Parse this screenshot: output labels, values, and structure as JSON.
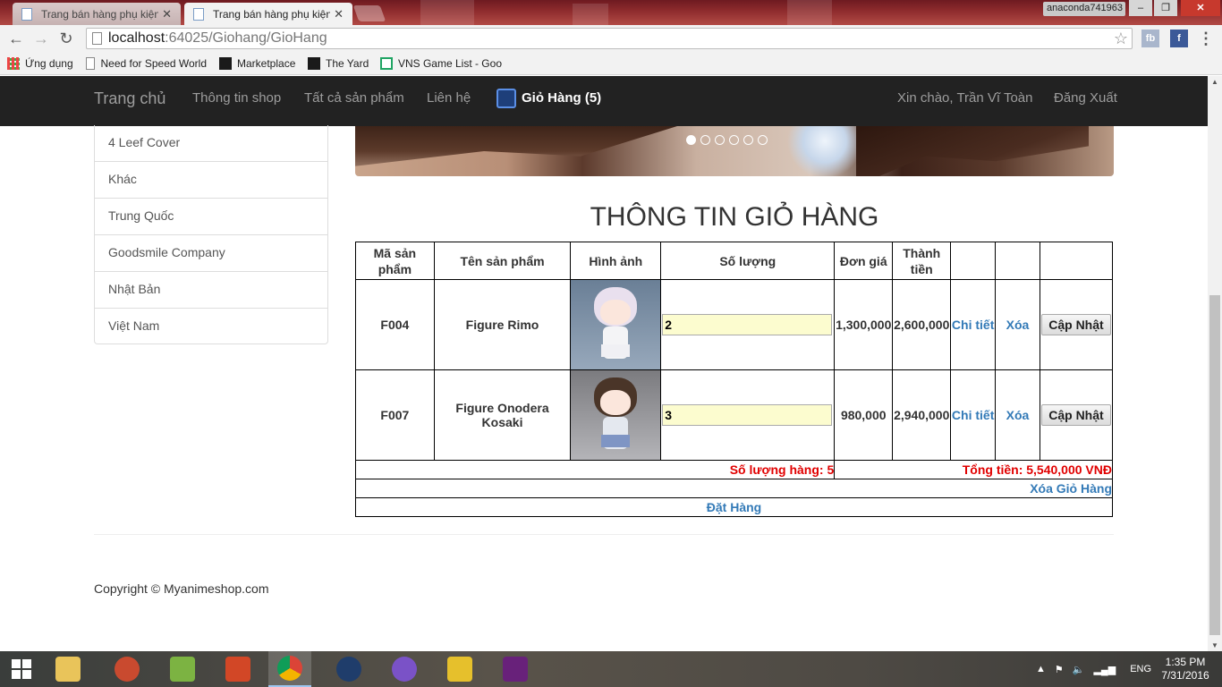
{
  "browser": {
    "tabs": [
      {
        "title": "Trang bán hàng phụ kiện",
        "active": false
      },
      {
        "title": "Trang bán hàng phụ kiện",
        "active": true
      }
    ],
    "profile": "anaconda741963",
    "url_host": "localhost",
    "url_path": ":64025/Giohang/GioHang",
    "bookmarks": [
      "Ứng dụng",
      "Need for Speed World",
      "Marketplace",
      "The Yard",
      "VNS Game List - Goo"
    ],
    "extensions": [
      "fb"
    ]
  },
  "navbar": {
    "brand": "Trang chủ",
    "links": [
      "Thông tin shop",
      "Tất cả sản phẩm",
      "Liên hệ"
    ],
    "cart": "Giỏ Hàng (5)",
    "greeting": "Xin chào, Trần Vĩ Toàn",
    "logout": "Đăng Xuất"
  },
  "sidebar": {
    "items": [
      "4 Leef Cover",
      "Khác",
      "Trung Quốc",
      "Goodsmile Company",
      "Nhật Bản",
      "Việt Nam"
    ]
  },
  "carousel": {
    "slide_count": 6,
    "active_index": 0
  },
  "cart": {
    "title": "THÔNG TIN GIỎ HÀNG",
    "headers": [
      "Mã sản phẩm",
      "Tên sản phẩm",
      "Hình ảnh",
      "Số lượng",
      "Đơn giá",
      "Thành tiền",
      "",
      "",
      ""
    ],
    "rows": [
      {
        "code": "F004",
        "name": "Figure Rimo",
        "image": "figure-rimo-image",
        "qty": "2",
        "price": "1,300,000",
        "total": "2,600,000",
        "detail": "Chi tiết",
        "delete": "Xóa",
        "update": "Cập Nhật"
      },
      {
        "code": "F007",
        "name": "Figure Onodera Kosaki",
        "image": "figure-onodera-kosaki-image",
        "qty": "3",
        "price": "980,000",
        "total": "2,940,000",
        "detail": "Chi tiết",
        "delete": "Xóa",
        "update": "Cập Nhật"
      }
    ],
    "quantity_total": "Số lượng hàng: 5",
    "grand_total": "Tổng tiền: 5,540,000 VNĐ",
    "clear_cart": "Xóa Giỏ Hàng",
    "order": "Đặt Hàng"
  },
  "footer": {
    "copyright": "Copyright © Myanimeshop.com"
  },
  "taskbar": {
    "language": "ENG",
    "time": "1:35 PM",
    "date": "7/31/2016"
  },
  "colors": {
    "navbar_bg": "#222222",
    "link": "#337ab7",
    "total_red": "#e10000",
    "qty_bg": "#fcfccf"
  }
}
